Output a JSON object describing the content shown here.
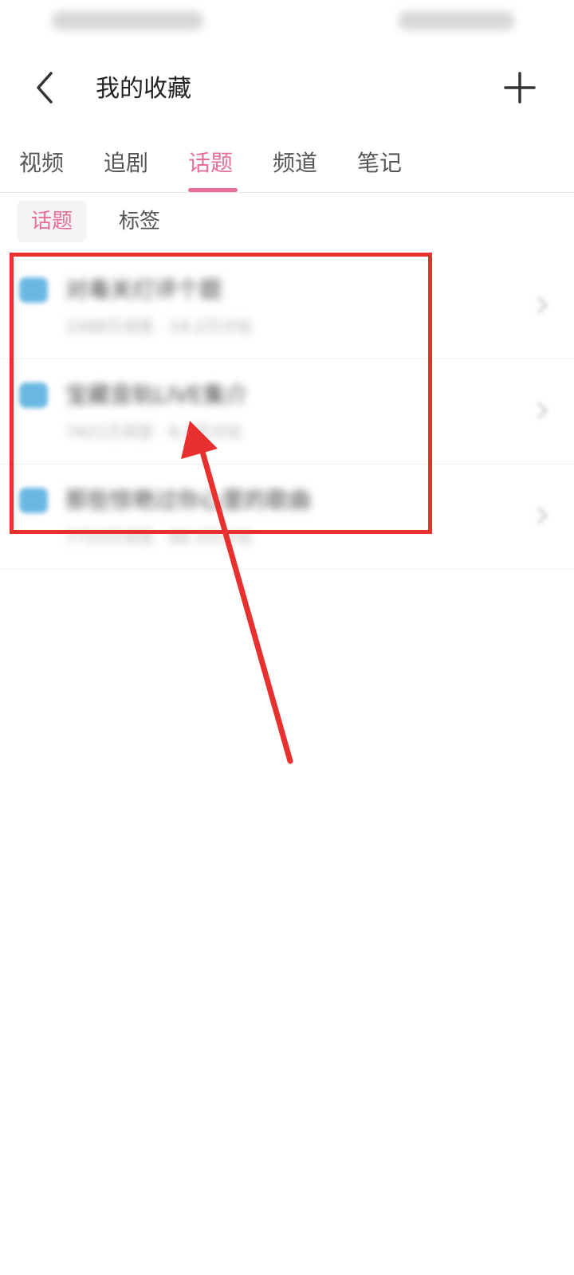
{
  "header": {
    "title": "我的收藏"
  },
  "tabs": [
    {
      "label": "视频"
    },
    {
      "label": "追剧"
    },
    {
      "label": "话题"
    },
    {
      "label": "频道"
    },
    {
      "label": "笔记"
    }
  ],
  "active_tab": "话题",
  "subtabs": [
    {
      "label": "话题"
    },
    {
      "label": "标签"
    }
  ],
  "active_subtab": "话题",
  "items": [
    {
      "title": "对毒关灯评个题",
      "meta": "1568万浏览 · 19.2万讨论"
    },
    {
      "title": "宝藏音轨LIVE集介",
      "meta": "7421万浏览 · 6.2万讨论"
    },
    {
      "title": "那些惊艳过你心里的歌曲",
      "meta": "7753万浏览 · 88.3万讨论"
    }
  ],
  "colors": {
    "accent": "#e86d9a",
    "highlight": "#e8312f",
    "topic_icon": "#6bb9e3"
  },
  "icons": {
    "back": "chevron-left-icon",
    "add": "plus-icon",
    "topic": "topic-icon",
    "chevron": "chevron-right-icon"
  }
}
